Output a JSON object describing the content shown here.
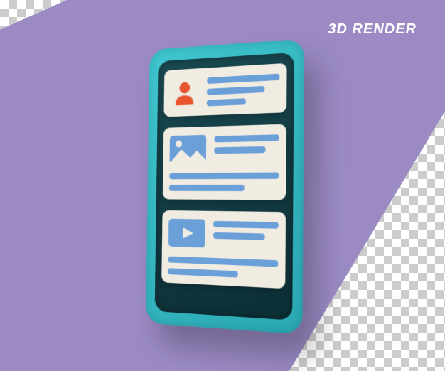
{
  "label": "3D RENDER",
  "colors": {
    "purple": "#9b8ac4",
    "phone_body": "#3fc6d0",
    "screen": "#1a4a52",
    "card_bg": "#f0ece2",
    "line": "#6b9fd8",
    "user_icon": "#e8552f",
    "image_icon": "#6b9fd8",
    "play_icon": "#6b9fd8"
  },
  "cards": [
    {
      "icon": "user-icon"
    },
    {
      "icon": "image-icon"
    },
    {
      "icon": "play-icon"
    }
  ]
}
